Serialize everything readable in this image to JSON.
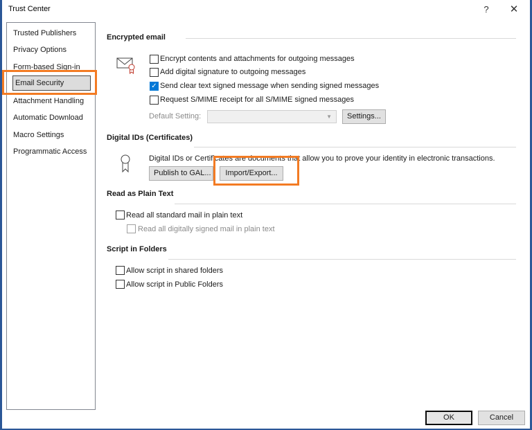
{
  "window": {
    "title": "Trust Center",
    "help_label": "?",
    "close_label": "✕"
  },
  "sidebar": {
    "items": [
      {
        "label": "Trusted Publishers"
      },
      {
        "label": "Privacy Options"
      },
      {
        "label": "Form-based Sign-in"
      },
      {
        "label": "Email Security",
        "selected": true
      },
      {
        "label": "Attachment Handling"
      },
      {
        "label": "Automatic Download"
      },
      {
        "label": "Macro Settings"
      },
      {
        "label": "Programmatic Access"
      }
    ]
  },
  "encrypted_email": {
    "title": "Encrypted email",
    "icon": "envelope-certificate-icon",
    "options": [
      {
        "label": "Encrypt contents and attachments for outgoing messages",
        "checked": false
      },
      {
        "label": "Add digital signature to outgoing messages",
        "checked": false
      },
      {
        "label": "Send clear text signed message when sending signed messages",
        "checked": true
      },
      {
        "label": "Request S/MIME receipt for all S/MIME signed messages",
        "checked": false
      }
    ],
    "default_setting_label": "Default Setting:",
    "default_setting_value": "",
    "settings_button": "Settings..."
  },
  "digital_ids": {
    "title": "Digital IDs (Certificates)",
    "icon": "certificate-ribbon-icon",
    "description": "Digital IDs or Certificates are documents that allow you to prove your identity in electronic transactions.",
    "publish_button": "Publish to GAL...",
    "import_export_button": "Import/Export..."
  },
  "plain_text": {
    "title": "Read as Plain Text",
    "options": [
      {
        "label": "Read all standard mail in plain text",
        "checked": false,
        "disabled": false
      },
      {
        "label": "Read all digitally signed mail in plain text",
        "checked": false,
        "disabled": true
      }
    ]
  },
  "script_in_folders": {
    "title": "Script in Folders",
    "options": [
      {
        "label": "Allow script in shared folders",
        "checked": false
      },
      {
        "label": "Allow script in Public Folders",
        "checked": false
      }
    ]
  },
  "footer": {
    "ok_label": "OK",
    "cancel_label": "Cancel"
  },
  "colors": {
    "highlight": "#f37b23",
    "checkbox_accent": "#0078d7",
    "window_border": "#2b5797"
  }
}
